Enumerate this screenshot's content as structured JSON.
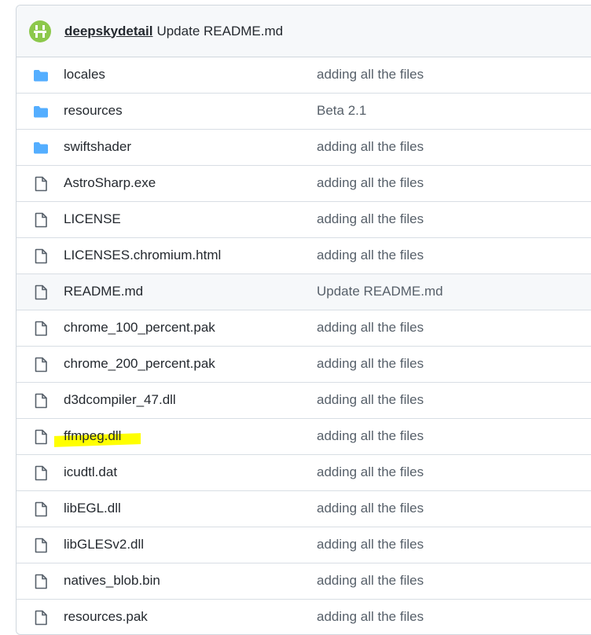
{
  "commit": {
    "author": "deepskydetail",
    "message": "Update README.md"
  },
  "colors": {
    "folder": "#54aeff",
    "file": "#57606a",
    "highlight": "#ffff00",
    "avatar": "#8cc84b"
  },
  "files": [
    {
      "name": "locales",
      "type": "folder",
      "commit": "adding all the files"
    },
    {
      "name": "resources",
      "type": "folder",
      "commit": "Beta 2.1"
    },
    {
      "name": "swiftshader",
      "type": "folder",
      "commit": "adding all the files"
    },
    {
      "name": "AstroSharp.exe",
      "type": "file",
      "commit": "adding all the files"
    },
    {
      "name": "LICENSE",
      "type": "file",
      "commit": "adding all the files"
    },
    {
      "name": "LICENSES.chromium.html",
      "type": "file",
      "commit": "adding all the files"
    },
    {
      "name": "README.md",
      "type": "file",
      "commit": "Update README.md"
    },
    {
      "name": "chrome_100_percent.pak",
      "type": "file",
      "commit": "adding all the files"
    },
    {
      "name": "chrome_200_percent.pak",
      "type": "file",
      "commit": "adding all the files"
    },
    {
      "name": "d3dcompiler_47.dll",
      "type": "file",
      "commit": "adding all the files"
    },
    {
      "name": "ffmpeg.dll",
      "type": "file",
      "commit": "adding all the files"
    },
    {
      "name": "icudtl.dat",
      "type": "file",
      "commit": "adding all the files"
    },
    {
      "name": "libEGL.dll",
      "type": "file",
      "commit": "adding all the files"
    },
    {
      "name": "libGLESv2.dll",
      "type": "file",
      "commit": "adding all the files"
    },
    {
      "name": "natives_blob.bin",
      "type": "file",
      "commit": "adding all the files"
    },
    {
      "name": "resources.pak",
      "type": "file",
      "commit": "adding all the files"
    }
  ]
}
